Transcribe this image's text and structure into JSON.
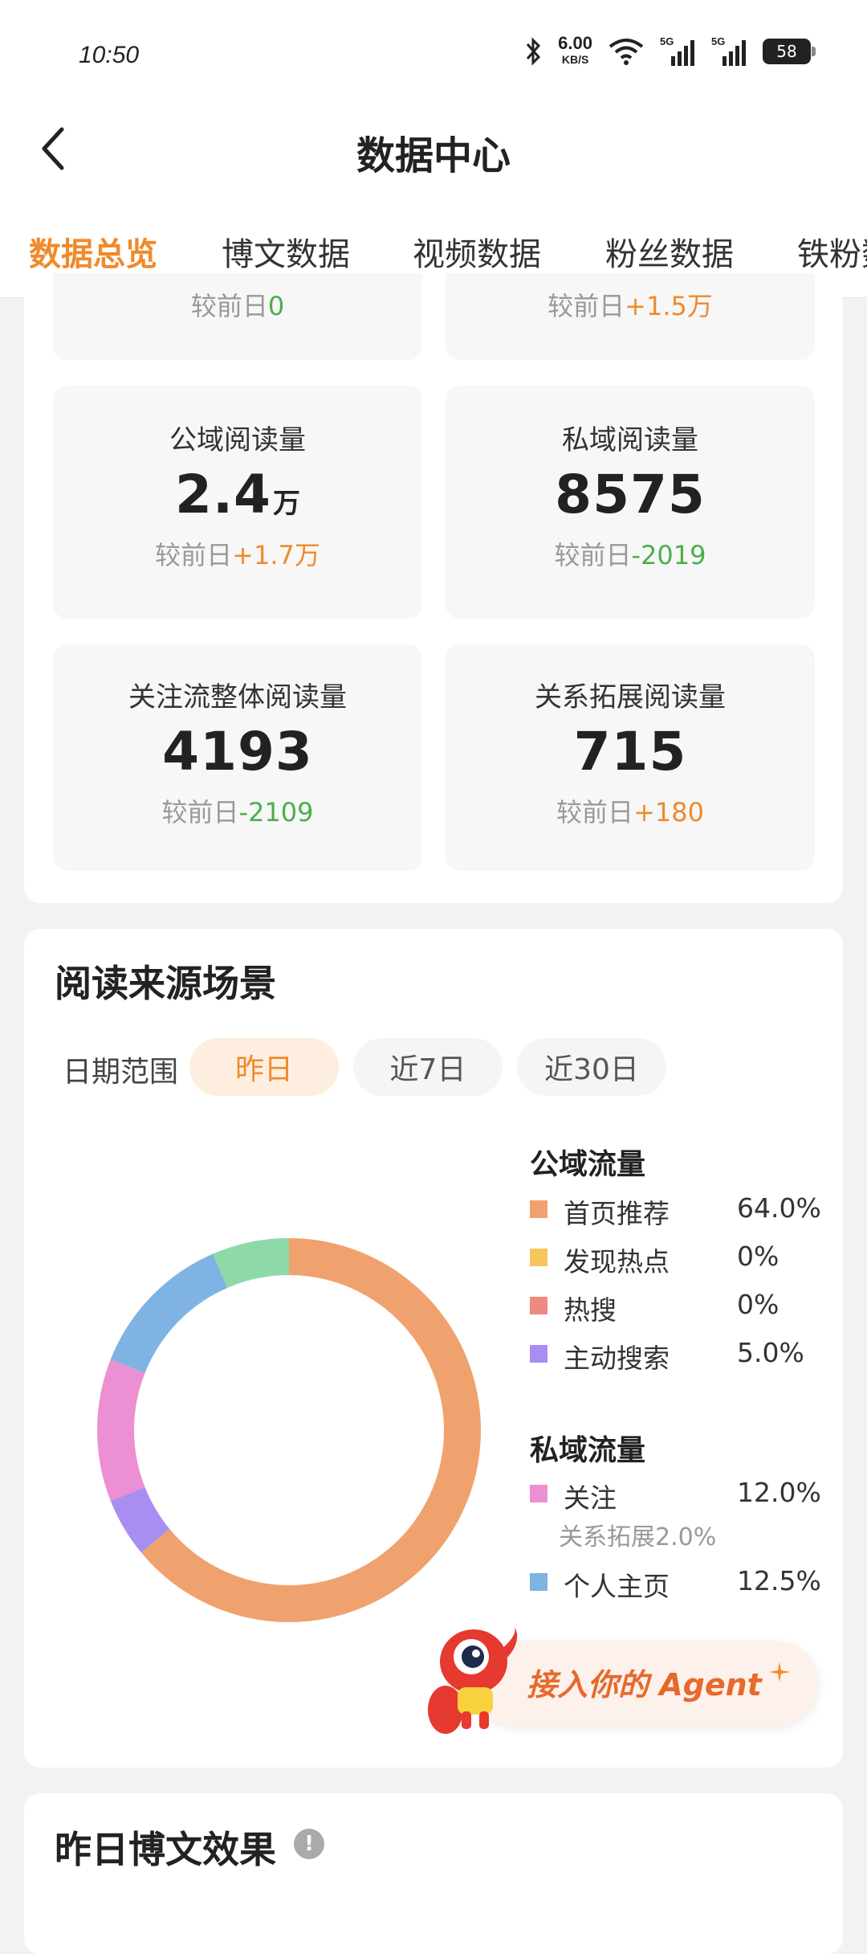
{
  "status_bar": {
    "time": "10:50",
    "net_speed": "6.00",
    "net_unit": "KB/S",
    "signal1": "5G",
    "signal2": "5G",
    "battery": "58"
  },
  "header": {
    "title": "数据中心"
  },
  "tabs": [
    {
      "label": "数据总览",
      "active": true
    },
    {
      "label": "博文数据"
    },
    {
      "label": "视频数据"
    },
    {
      "label": "粉丝数据"
    },
    {
      "label": "铁粉数"
    }
  ],
  "top_partial": {
    "left_delta_prefix": "较前日",
    "left_delta": "0",
    "right_delta_prefix": "较前日",
    "right_delta": "+1.5万"
  },
  "stats": [
    {
      "label": "公域阅读量",
      "value": "2.4",
      "unit": "万",
      "delta_prefix": "较前日",
      "delta": "+1.7万",
      "trend": "up"
    },
    {
      "label": "私域阅读量",
      "value": "8575",
      "unit": "",
      "delta_prefix": "较前日",
      "delta": "-2019",
      "trend": "down"
    },
    {
      "label": "关注流整体阅读量",
      "value": "4193",
      "unit": "",
      "delta_prefix": "较前日",
      "delta": "-2109",
      "trend": "down"
    },
    {
      "label": "关系拓展阅读量",
      "value": "715",
      "unit": "",
      "delta_prefix": "较前日",
      "delta": "+180",
      "trend": "up"
    }
  ],
  "reading_source": {
    "title": "阅读来源场景",
    "date_range_label": "日期范围",
    "chips": [
      "昨日",
      "近7日",
      "近30日"
    ],
    "public_title": "公域流量",
    "private_title": "私域流量",
    "public_items": [
      {
        "name": "首页推荐",
        "pct": "64.0%",
        "color": "#f0a26e"
      },
      {
        "name": "发现热点",
        "pct": "0%",
        "color": "#f7c55e"
      },
      {
        "name": "热搜",
        "pct": "0%",
        "color": "#ef8a82"
      },
      {
        "name": "主动搜索",
        "pct": "5.0%",
        "color": "#a98ef2"
      }
    ],
    "private_items": [
      {
        "name": "关注",
        "pct": "12.0%",
        "color": "#ec8fd3",
        "sub": "关系拓展2.0%"
      },
      {
        "name": "个人主页",
        "pct": "12.5%",
        "color": "#7fb3e3"
      }
    ]
  },
  "chart_data": {
    "type": "pie",
    "labels": [
      "首页推荐",
      "发现热点",
      "热搜",
      "主动搜索",
      "关注",
      "个人主页",
      ""
    ],
    "values": [
      64.0,
      0,
      0,
      5.0,
      12.0,
      12.5,
      6.5
    ],
    "colors": [
      "#f0a26e",
      "#f7c55e",
      "#ef8a82",
      "#a98ef2",
      "#ec8fd3",
      "#7fb3e3",
      "#8ed9a9"
    ]
  },
  "agent": {
    "label": "接入你的 Agent"
  },
  "yesterday": {
    "title": "昨日博文效果"
  }
}
